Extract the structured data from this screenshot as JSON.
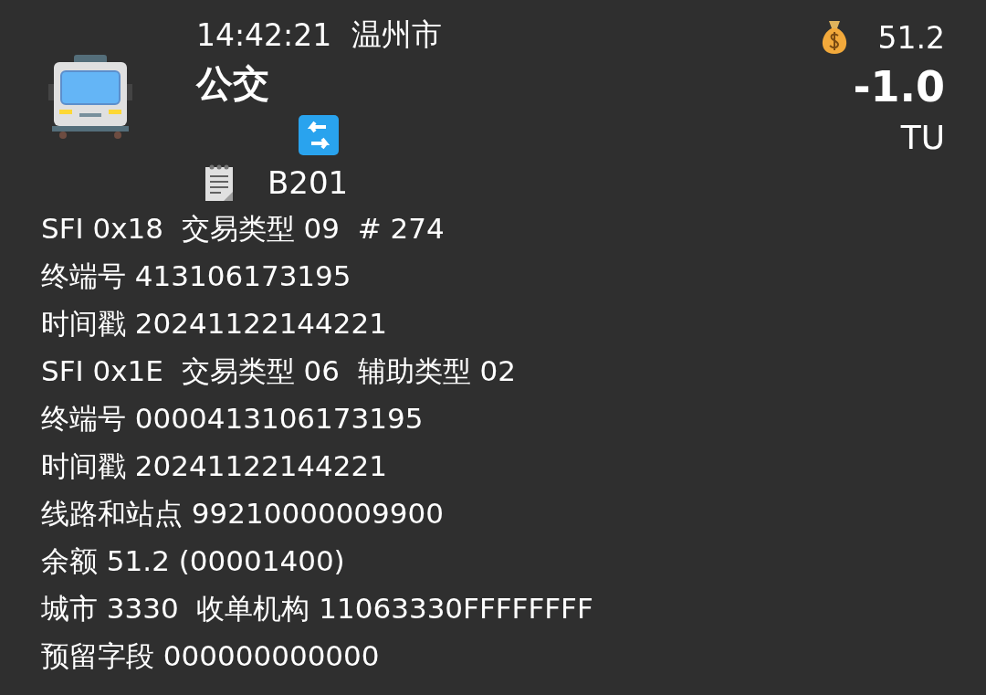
{
  "header": {
    "time": "14:42:21",
    "city": "温州市",
    "category": "公交",
    "code": "B201",
    "balance": "51.2",
    "amount": "-1.0",
    "unit": "TU"
  },
  "lines": [
    "SFI 0x18  交易类型 09  # 274",
    "终端号 413106173195",
    "时间戳 20241122144221",
    "SFI 0x1E  交易类型 06  辅助类型 02",
    "终端号 0000413106173195",
    "时间戳 20241122144221",
    "线路和站点 99210000009900",
    "余额 51.2 (00001400)",
    "城市 3330  收单机构 11063330FFFFFFFF",
    "预留字段 000000000000"
  ]
}
